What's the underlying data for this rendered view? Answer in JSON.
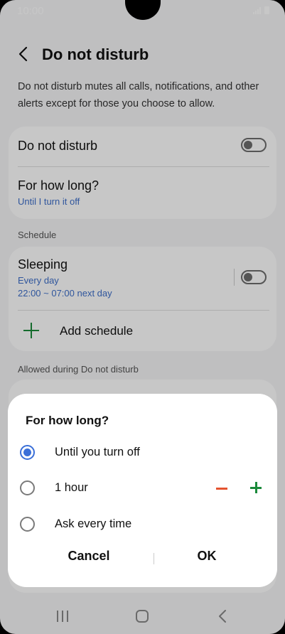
{
  "status_bar": {
    "time": "10:00"
  },
  "header": {
    "title": "Do not disturb"
  },
  "description": "Do not disturb mutes all calls, notifications, and other alerts except for those you choose to allow.",
  "main_card": {
    "dnd_label": "Do not disturb",
    "dnd_toggle_on": false,
    "duration_label": "For how long?",
    "duration_value": "Until I turn it off"
  },
  "schedule": {
    "section_label": "Schedule",
    "sleeping_label": "Sleeping",
    "sleeping_days": "Every day",
    "sleeping_time": "22:00 ~ 07:00 next day",
    "sleeping_toggle_on": false,
    "add_label": "Add schedule"
  },
  "allowed_section_label": "Allowed during Do not disturb",
  "dialog": {
    "title": "For how long?",
    "options": [
      {
        "label": "Until you turn off",
        "selected": true
      },
      {
        "label": "1 hour",
        "selected": false
      },
      {
        "label": "Ask every time",
        "selected": false
      }
    ],
    "cancel_label": "Cancel",
    "ok_label": "OK"
  },
  "colors": {
    "accent_blue": "#3a6fd8",
    "plus_green": "#1a8a3a",
    "minus_red": "#e4532f",
    "link_blue": "#3e6fc9"
  }
}
